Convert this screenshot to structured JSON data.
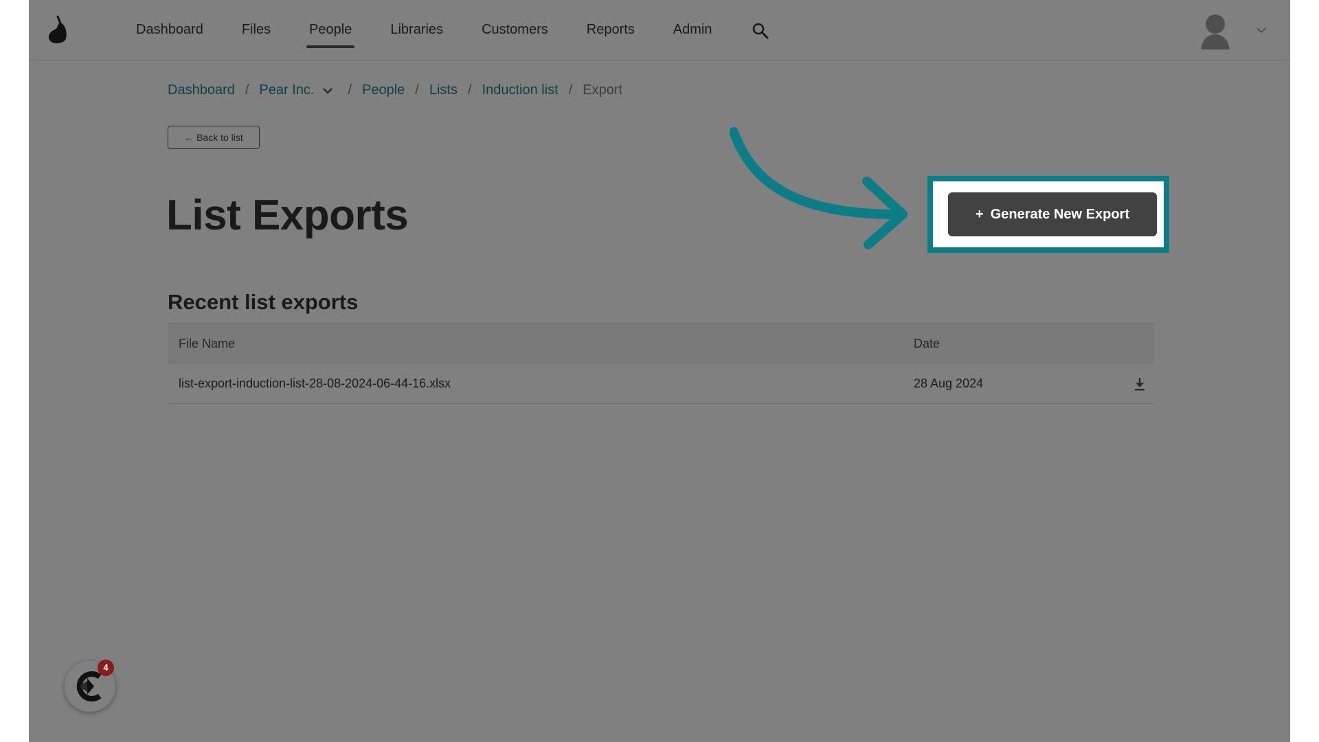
{
  "nav": {
    "items": [
      {
        "label": "Dashboard",
        "active": false
      },
      {
        "label": "Files",
        "active": false
      },
      {
        "label": "People",
        "active": true
      },
      {
        "label": "Libraries",
        "active": false
      },
      {
        "label": "Customers",
        "active": false
      },
      {
        "label": "Reports",
        "active": false
      },
      {
        "label": "Admin",
        "active": false
      }
    ],
    "search_icon": "search-icon",
    "avatar_icon": "user-avatar-icon"
  },
  "breadcrumb": {
    "items": [
      "Dashboard",
      "Pear Inc.",
      "People",
      "Lists",
      "Induction list",
      "Export"
    ],
    "separator": "/"
  },
  "back_button": {
    "label": "← Back to list"
  },
  "page_title": "List Exports",
  "generate_button": {
    "icon": "+",
    "label": "Generate New Export"
  },
  "recent": {
    "title": "Recent list exports",
    "columns": [
      "File Name",
      "Date"
    ],
    "rows": [
      {
        "file_name": "list-export-induction-list-28-08-2024-06-44-16.xlsx",
        "date": "28 Aug 2024"
      }
    ]
  },
  "chat_widget": {
    "badge_count": "4"
  },
  "colors": {
    "overlay": "#808080",
    "accent_teal": "#0c7d86",
    "button_dark": "#424242",
    "badge_red": "#8a1b1b",
    "link": "#0f3f46"
  }
}
